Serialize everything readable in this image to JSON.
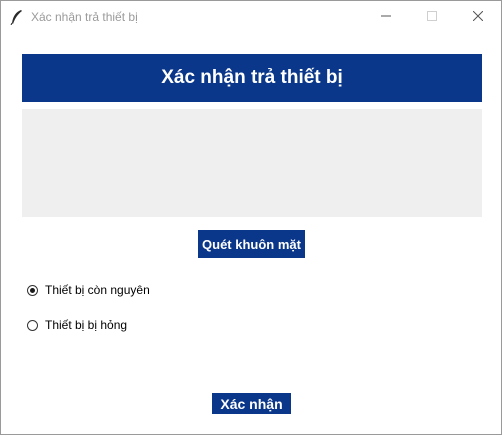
{
  "window": {
    "title": "Xác nhận trả thiết bị",
    "controls": [
      "minimize-icon",
      "maximize-icon",
      "close-icon"
    ]
  },
  "header": {
    "title": "Xác nhận trả thiết bị",
    "background": "#0a3789"
  },
  "camera_area": {
    "background": "#efefef"
  },
  "scan_button": {
    "label": "Quét khuôn mặt"
  },
  "condition_options": [
    {
      "label": "Thiết bị còn nguyên",
      "selected": true
    },
    {
      "label": "Thiết bị bị hỏng",
      "selected": false
    }
  ],
  "confirm_button": {
    "label": "Xác nhận"
  },
  "colors": {
    "accent": "#0a3789",
    "text": "#000000",
    "title_text": "#9a9a9a"
  }
}
